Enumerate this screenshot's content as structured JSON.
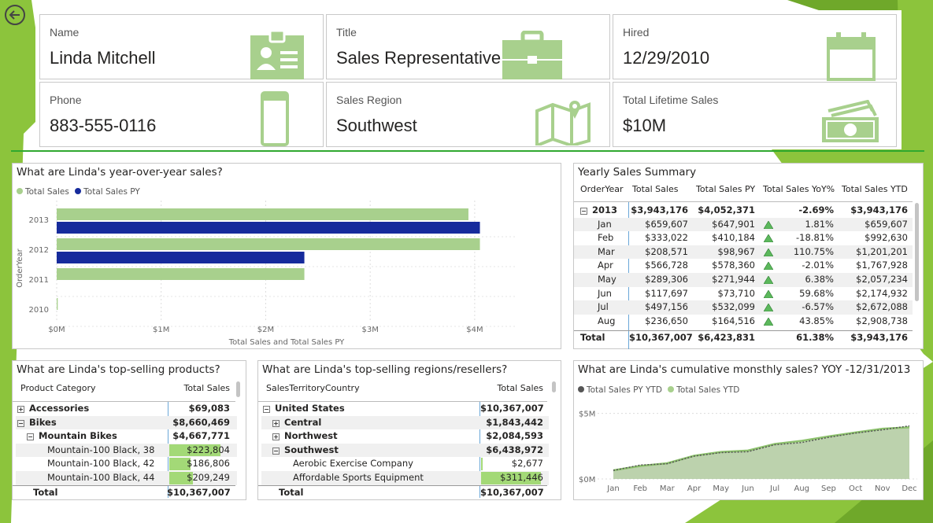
{
  "colors": {
    "accent": "#a8d08d",
    "navy": "#162b9c",
    "bg_green": "#8cc43c",
    "dark_green": "#4f8a10"
  },
  "kpis": [
    {
      "label": "Name",
      "value": "Linda Mitchell",
      "icon": "id-card-icon"
    },
    {
      "label": "Title",
      "value": "Sales Representative",
      "icon": "briefcase-icon"
    },
    {
      "label": "Hired",
      "value": "12/29/2010",
      "icon": "calendar-icon"
    },
    {
      "label": "Phone",
      "value": "883-555-0116",
      "icon": "phone-icon"
    },
    {
      "label": "Sales Region",
      "value": "Southwest",
      "icon": "map-icon"
    },
    {
      "label": "Total Lifetime Sales",
      "value": "$10M",
      "icon": "money-icon"
    }
  ],
  "yoy_chart": {
    "title": "What are Linda's year-over-year sales?",
    "legend": [
      "Total Sales",
      "Total Sales PY"
    ],
    "ylabel": "OrderYear",
    "xlabel": "Total Sales and Total Sales PY",
    "x_ticks": [
      "$0M",
      "$1M",
      "$2M",
      "$3M",
      "$4M"
    ]
  },
  "chart_data": [
    {
      "type": "bar",
      "orientation": "horizontal",
      "title": "What are Linda's year-over-year sales?",
      "categories": [
        "2013",
        "2012",
        "2011",
        "2010"
      ],
      "series": [
        {
          "name": "Total Sales",
          "values": [
            3.94,
            4.05,
            2.37,
            0.01
          ]
        },
        {
          "name": "Total Sales PY",
          "values": [
            4.05,
            2.37,
            0,
            0
          ]
        }
      ],
      "xlabel": "Total Sales and Total Sales PY",
      "ylabel": "OrderYear",
      "xlim": [
        0,
        4.4
      ],
      "grid": true,
      "legend": "top-left"
    },
    {
      "type": "area",
      "title": "What are Linda's cumulative monsthly sales? YOY -12/31/2013",
      "categories": [
        "Jan",
        "Feb",
        "Mar",
        "Apr",
        "May",
        "Jun",
        "Jul",
        "Aug",
        "Sep",
        "Oct",
        "Nov",
        "Dec"
      ],
      "series": [
        {
          "name": "Total Sales PY YTD",
          "values": [
            0.65,
            1.06,
            1.16,
            1.74,
            2.01,
            2.08,
            2.61,
            2.78,
            3.18,
            3.5,
            3.75,
            4.05
          ]
        },
        {
          "name": "Total Sales YTD",
          "values": [
            0.66,
            0.99,
            1.2,
            1.77,
            2.06,
            2.17,
            2.67,
            2.91,
            3.25,
            3.55,
            3.83,
            3.94
          ]
        }
      ],
      "ylim": [
        0,
        5.4
      ],
      "y_ticks": [
        "$0M",
        "$5M"
      ],
      "legend": "top-left"
    }
  ],
  "yearly": {
    "title": "Yearly Sales Summary",
    "headers": [
      "OrderYear",
      "Total Sales",
      "Total Sales PY",
      "Total Sales YoY%",
      "Total Sales YTD"
    ],
    "year_row": {
      "label": "2013",
      "sales": "$3,943,176",
      "py": "$4,052,371",
      "yoy": "-2.69%",
      "ytd": "$3,943,176"
    },
    "rows": [
      {
        "label": "Jan",
        "sales": "$659,607",
        "py": "$647,901",
        "yoy": "1.81%",
        "ytd": "$659,607"
      },
      {
        "label": "Feb",
        "sales": "$333,022",
        "py": "$410,184",
        "yoy": "-18.81%",
        "ytd": "$992,630"
      },
      {
        "label": "Mar",
        "sales": "$208,571",
        "py": "$98,967",
        "yoy": "110.75%",
        "ytd": "$1,201,201"
      },
      {
        "label": "Apr",
        "sales": "$566,728",
        "py": "$578,360",
        "yoy": "-2.01%",
        "ytd": "$1,767,928"
      },
      {
        "label": "May",
        "sales": "$289,306",
        "py": "$271,944",
        "yoy": "6.38%",
        "ytd": "$2,057,234"
      },
      {
        "label": "Jun",
        "sales": "$117,697",
        "py": "$73,710",
        "yoy": "59.68%",
        "ytd": "$2,174,932"
      },
      {
        "label": "Jul",
        "sales": "$497,156",
        "py": "$532,099",
        "yoy": "-6.57%",
        "ytd": "$2,672,088"
      },
      {
        "label": "Aug",
        "sales": "$236,650",
        "py": "$164,516",
        "yoy": "43.85%",
        "ytd": "$2,908,738"
      }
    ],
    "total": {
      "label": "Total",
      "sales": "$10,367,007",
      "py": "$6,423,831",
      "yoy": "61.38%",
      "ytd": "$3,943,176"
    }
  },
  "products": {
    "title": "What are Linda's top-selling products?",
    "headers": [
      "Product Category",
      "Total Sales"
    ],
    "rows": [
      {
        "label": "Accessories",
        "value": "$69,083",
        "level": 0,
        "expander": "+",
        "bold": true,
        "fill": 0
      },
      {
        "label": "Bikes",
        "value": "$8,660,469",
        "level": 0,
        "expander": "−",
        "bold": true,
        "fill": 0
      },
      {
        "label": "Mountain Bikes",
        "value": "$4,667,771",
        "level": 1,
        "expander": "−",
        "bold": true,
        "fill": 0
      },
      {
        "label": "Mountain-100 Black, 38",
        "value": "$223,804",
        "level": 2,
        "expander": "",
        "bold": false,
        "fill": 0.85
      },
      {
        "label": "Mountain-100 Black, 42",
        "value": "$186,806",
        "level": 2,
        "expander": "",
        "bold": false,
        "fill": 0.35
      },
      {
        "label": "Mountain-100 Black, 44",
        "value": "$209,249",
        "level": 2,
        "expander": "",
        "bold": false,
        "fill": 0.4
      }
    ],
    "total": {
      "label": "Total",
      "value": "$10,367,007"
    }
  },
  "regions": {
    "title": "What are Linda's top-selling regions/resellers?",
    "headers": [
      "SalesTerritoryCountry",
      "Total Sales"
    ],
    "rows": [
      {
        "label": "United States",
        "value": "$10,367,007",
        "level": 0,
        "expander": "−",
        "bold": true,
        "fill": 0
      },
      {
        "label": "Central",
        "value": "$1,843,442",
        "level": 1,
        "expander": "+",
        "bold": true,
        "fill": 0
      },
      {
        "label": "Northwest",
        "value": "$2,084,593",
        "level": 1,
        "expander": "+",
        "bold": true,
        "fill": 0
      },
      {
        "label": "Southwest",
        "value": "$6,438,972",
        "level": 1,
        "expander": "−",
        "bold": true,
        "fill": 0
      },
      {
        "label": "Aerobic Exercise Company",
        "value": "$2,677",
        "level": 2,
        "expander": "",
        "bold": false,
        "fill": 0.02
      },
      {
        "label": "Affordable Sports Equipment",
        "value": "$311,446",
        "level": 2,
        "expander": "",
        "bold": false,
        "fill": 1
      }
    ],
    "total": {
      "label": "Total",
      "value": "$10,367,007"
    }
  },
  "cumulative": {
    "title": "What are Linda's cumulative monsthly sales? YOY -12/31/2013",
    "legend": [
      "Total Sales PY YTD",
      "Total Sales YTD"
    ]
  }
}
